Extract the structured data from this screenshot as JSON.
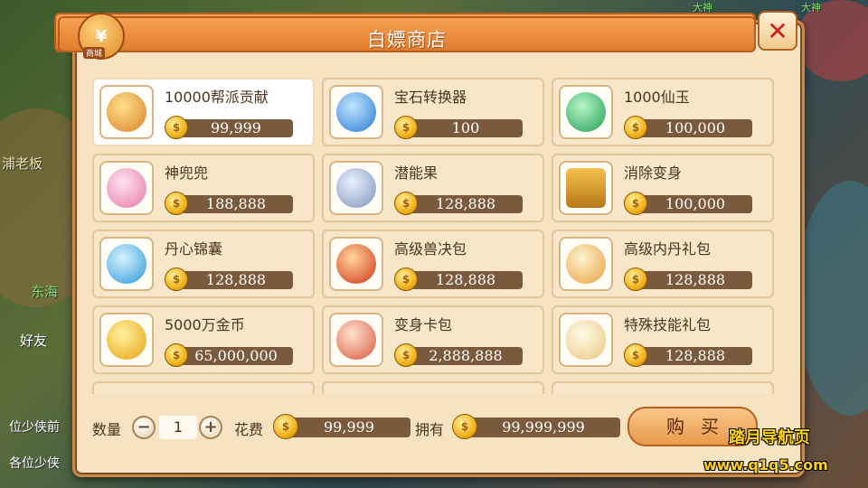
{
  "background": {
    "left_texts": [
      "浦老板",
      "东海",
      "好友",
      "位少侠前",
      "各位少侠"
    ],
    "top_right_texts": [
      "大神",
      "大神"
    ]
  },
  "shop": {
    "title": "白嫖商店",
    "badge_symbol": "¥",
    "badge_label": "商城",
    "close_symbol": "✕"
  },
  "items": [
    {
      "name": "10000帮派贡献",
      "price": "99,999",
      "icon": "guild-contribution-icon",
      "color": "#e0a040"
    },
    {
      "name": "宝石转换器",
      "price": "100",
      "icon": "gem-converter-icon",
      "color": "#3a8fe0"
    },
    {
      "name": "1000仙玉",
      "price": "100,000",
      "icon": "jade-icon",
      "color": "#39c06a"
    },
    {
      "name": "神兜兜",
      "price": "188,888",
      "icon": "pouch-icon",
      "color": "#f29ac2"
    },
    {
      "name": "潜能果",
      "price": "128,888",
      "icon": "potential-fruit-icon",
      "color": "#8fa6c8"
    },
    {
      "name": "消除变身",
      "price": "100,000",
      "icon": "remove-transform-card-icon",
      "color": "#d9a12a"
    },
    {
      "name": "丹心锦囊",
      "price": "128,888",
      "icon": "brocade-bag-icon",
      "color": "#4ab0e8"
    },
    {
      "name": "高级兽决包",
      "price": "128,888",
      "icon": "beast-skill-pack-icon",
      "color": "#e04a2a"
    },
    {
      "name": "高级内丹礼包",
      "price": "128,888",
      "icon": "inner-pill-pack-icon",
      "color": "#f0b860"
    },
    {
      "name": "5000万金币",
      "price": "65,000,000",
      "icon": "gold-coin-icon",
      "color": "#f2b21c"
    },
    {
      "name": "变身卡包",
      "price": "2,888,888",
      "icon": "transform-card-pack-icon",
      "color": "#e86a4a"
    },
    {
      "name": "特殊技能礼包",
      "price": "128,888",
      "icon": "special-skill-pack-icon",
      "color": "#f7e7b0"
    }
  ],
  "footer": {
    "quantity_label": "数量",
    "minus": "−",
    "plus": "+",
    "quantity": "1",
    "cost_label": "花费",
    "cost_value": "99,999",
    "own_label": "拥有",
    "own_value": "99,999,999",
    "buy_label": "购买"
  },
  "watermark": {
    "line1": "踏月导航页",
    "line2": "www.q1q5.com"
  }
}
